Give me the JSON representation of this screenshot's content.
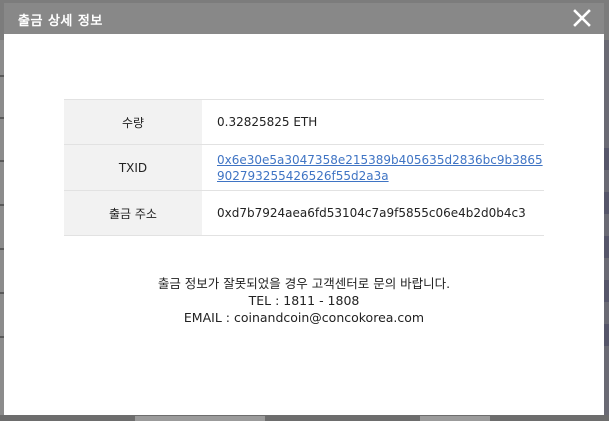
{
  "modal": {
    "title": "출금 상세 정보",
    "close_icon": "close-icon"
  },
  "details": {
    "amount_label": "수량",
    "amount_value": "0.32825825 ETH",
    "txid_label": "TXID",
    "txid_value": "0x6e30e5a3047358e215389b405635d2836bc9b3865902793255426526f55d2a3a",
    "address_label": "출금 주소",
    "address_value": "0xd7b7924aea6fd53104c7a9f5855c06e4b2d0b4c3"
  },
  "notice": {
    "message": "출금 정보가 잘못되었을 경우 고객센터로 문의 바랍니다.",
    "tel": "TEL : 1811 - 1808",
    "email": "EMAIL : coinandcoin@concokorea.com"
  },
  "colors": {
    "header_bg": "#888888",
    "link": "#3f74c4",
    "label_bg": "#f2f2f2"
  }
}
